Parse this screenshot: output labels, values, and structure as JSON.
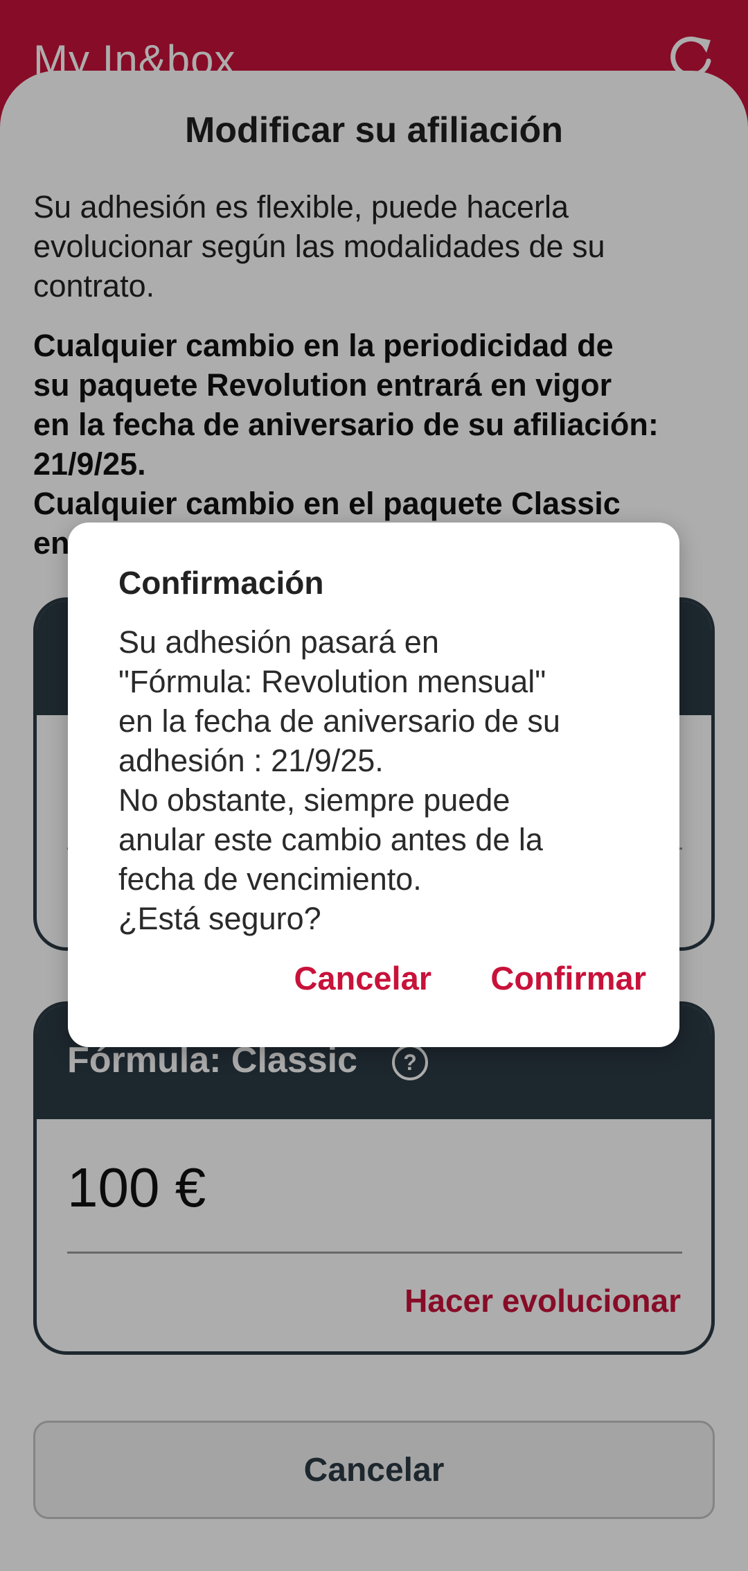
{
  "app": {
    "title": "My In&box",
    "refresh_icon": "refresh-icon"
  },
  "sheet": {
    "title": "Modificar su afiliación",
    "intro_lines": [
      "Su adhesión es flexible, puede hacerla",
      "evolucionar según las modalidades de su",
      "contrato."
    ],
    "notice_lines": [
      "Cualquier cambio en la periodicidad de",
      "su paquete Revolution entrará en vigor",
      "en la fecha de aniversario de su afiliación:",
      "21/9/25.",
      "Cualquier cambio en el paquete Classic",
      "en"
    ],
    "card_classic": {
      "label": "Fórmula: Classic",
      "price": "100 €",
      "action": "Hacer evolucionar"
    },
    "cancel_label": "Cancelar"
  },
  "dialog": {
    "title": "Confirmación",
    "body_lines": [
      "Su adhesión pasará en",
      "\"Fórmula: Revolution mensual\"",
      "en la fecha de aniversario de su",
      "adhesión : 21/9/25.",
      "No obstante, siempre puede",
      "anular este cambio antes de la",
      "fecha de vencimiento.",
      "¿Está seguro?"
    ],
    "cancel_label": "Cancelar",
    "confirm_label": "Confirmar"
  },
  "colors": {
    "brand": "#c8123a",
    "card_header": "#2b3a44"
  }
}
